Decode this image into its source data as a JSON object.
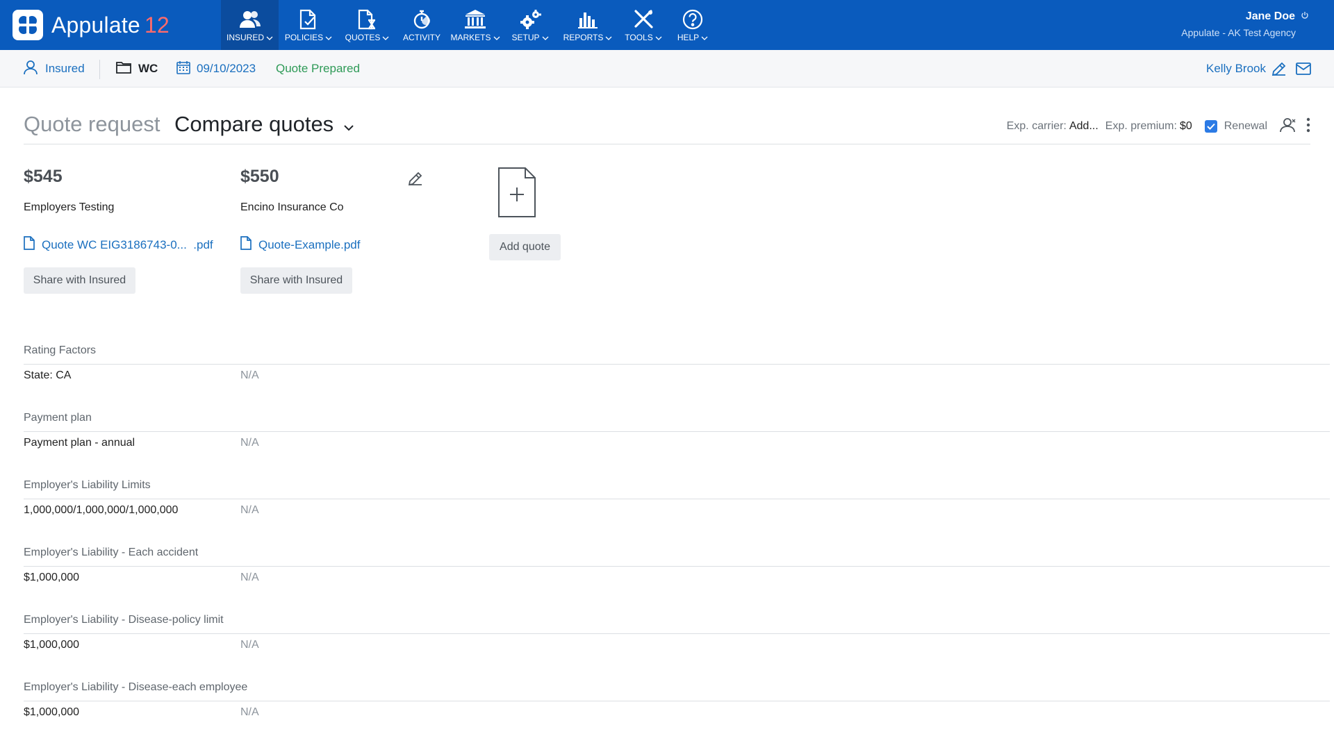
{
  "app": {
    "name": "Appulate",
    "version": "12"
  },
  "nav": {
    "items": [
      {
        "label": "INSURED",
        "icon": "users-icon"
      },
      {
        "label": "POLICIES",
        "icon": "policy-document-icon"
      },
      {
        "label": "QUOTES",
        "icon": "quote-hourglass-icon"
      },
      {
        "label": "ACTIVITY",
        "icon": "stopwatch-icon"
      },
      {
        "label": "MARKETS",
        "icon": "bank-icon"
      },
      {
        "label": "SETUP",
        "icon": "gears-icon"
      },
      {
        "label": "REPORTS",
        "icon": "bar-chart-icon"
      },
      {
        "label": "TOOLS",
        "icon": "tools-icon"
      },
      {
        "label": "HELP",
        "icon": "help-circle-icon"
      }
    ],
    "active": "INSURED"
  },
  "user": {
    "name": "Jane Doe",
    "agency": "Appulate - AK Test Agency"
  },
  "subbar": {
    "insured_label": "Insured",
    "line_of_business": "WC",
    "date": "09/10/2023",
    "status": "Quote Prepared",
    "assignee": "Kelly Brook"
  },
  "page": {
    "tab_inactive": "Quote request",
    "tab_active": "Compare quotes",
    "exp_carrier_label": "Exp. carrier:",
    "exp_carrier_value": "Add...",
    "exp_premium_label": "Exp. premium:",
    "exp_premium_value": "$0",
    "renewal_label": "Renewal"
  },
  "quotes": [
    {
      "price": "$545",
      "carrier": "Employers Testing",
      "file": "Quote WC EIG3186743-0...  .pdf",
      "share_label": "Share with Insured"
    },
    {
      "price": "$550",
      "carrier": "Encino Insurance Co",
      "file": "Quote-Example.pdf",
      "share_label": "Share with Insured"
    }
  ],
  "add_quote_label": "Add quote",
  "sections": [
    {
      "heading": "Rating Factors",
      "label": "State: CA",
      "value": "N/A"
    },
    {
      "heading": "Payment plan",
      "label": "Payment plan - annual",
      "value": "N/A"
    },
    {
      "heading": "Employer's Liability Limits",
      "label": "1,000,000/1,000,000/1,000,000",
      "value": "N/A"
    },
    {
      "heading": "Employer's Liability - Each accident",
      "label": "$1,000,000",
      "value": "N/A"
    },
    {
      "heading": "Employer's Liability - Disease-policy limit",
      "label": "$1,000,000",
      "value": "N/A"
    },
    {
      "heading": "Employer's Liability - Disease-each employee",
      "label": "$1,000,000",
      "value": "N/A"
    }
  ],
  "colors": {
    "nav_bg": "#0a5bbd",
    "nav_active_bg": "#0b4c9e",
    "link": "#1a6fbf",
    "status_green": "#2e9a57",
    "version_accent": "#ff6b6b"
  }
}
